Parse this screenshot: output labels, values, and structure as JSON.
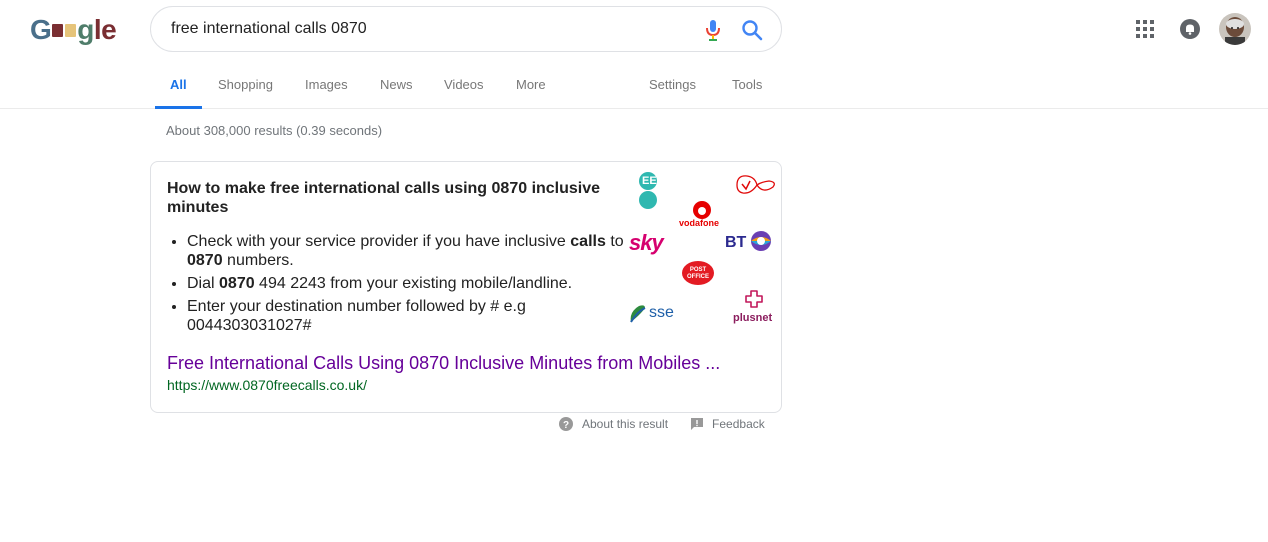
{
  "logo": {
    "letters": [
      "G",
      "g",
      "l",
      "e"
    ]
  },
  "search": {
    "query": "free international calls 0870"
  },
  "tabs": [
    {
      "label": "All"
    },
    {
      "label": "Shopping"
    },
    {
      "label": "Images"
    },
    {
      "label": "News"
    },
    {
      "label": "Videos"
    },
    {
      "label": "More"
    },
    {
      "label": "Settings"
    },
    {
      "label": "Tools"
    }
  ],
  "results_stats": "About 308,000 results (0.39 seconds)",
  "snippet": {
    "heading": "How to make free international calls using 0870 inclusive minutes",
    "bullets": [
      {
        "pre": "Check with your service provider if you have inclusive ",
        "bold1": "calls",
        "mid": " to ",
        "bold2": "0870",
        "post": " numbers."
      },
      {
        "pre": "Dial ",
        "bold1": "0870",
        "mid": " 494 2243 from your existing mobile/landline.",
        "bold2": "",
        "post": ""
      },
      {
        "pre": "Enter your destination number followed by # e.g 0044303031027#",
        "bold1": "",
        "mid": "",
        "bold2": "",
        "post": ""
      }
    ],
    "link_title": "Free International Calls Using 0870 Inclusive Minutes from Mobiles ...",
    "url": "https://www.0870freecalls.co.uk/",
    "brand_logos": {
      "ee": "EE",
      "vodafone": "vodafone",
      "sky": "sky",
      "bt": "BT",
      "post_office": [
        "POST",
        "OFFICE"
      ],
      "sse": "sse",
      "plusnet": "plusnet"
    }
  },
  "footer": {
    "about": "About this result",
    "feedback": "Feedback"
  },
  "colors": {
    "accent": "#1a73e8",
    "visited_link": "#660099",
    "url_green": "#006621"
  }
}
